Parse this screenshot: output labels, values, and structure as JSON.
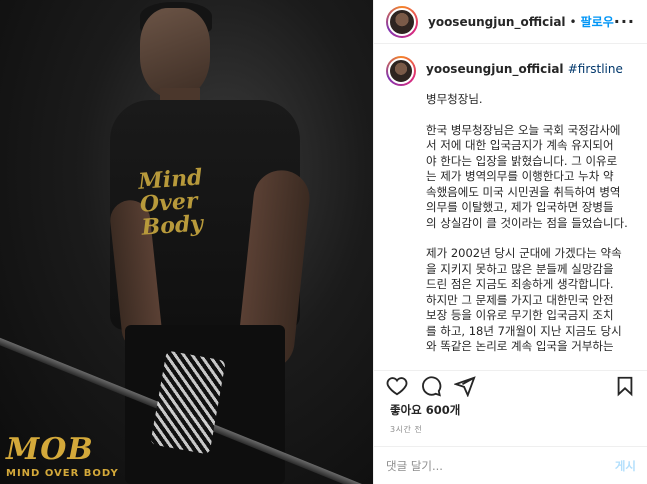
{
  "photo": {
    "shirt_lines": [
      "Mind",
      "Over",
      "Body"
    ],
    "logo": "MOB",
    "logo_sub": "MIND OVER BODY"
  },
  "header": {
    "username": "yooseungjun_official",
    "separator": "•",
    "follow_label": "팔로우",
    "more_icon": "ellipsis-icon"
  },
  "caption": {
    "username": "yooseungjun_official",
    "hashtag": "#firstline",
    "paragraphs": [
      "병무청장님.",
      "한국 병무청장님은 오늘 국회 국정감사에\n서 저에 대한 입국금지가 계속 유지되어\n야 한다는 입장을 밝혔습니다.  그 이유로\n는 제가 병역의무를 이행한다고 누차 약\n속했음에도 미국 시민권을 취득하여 병역\n의무를 이탈했고, 제가 입국하면 장병들\n의 상실감이 클 것이라는 점을 들었습니다.",
      "제가 2002년 당시 군대에 가겠다는 약속\n을 지키지 못하고 많은 분들께 실망감을\n드린 점은 지금도 죄송하게 생각합니다.\n하지만 그 문제를 가지고 대한민국 안전\n보장 등을 이유로 무기한 입국금지 조치\n를 하고, 18년 7개월이 지난 지금도 당시\n와 똑같은 논리로 계속 입국을 거부하는"
    ]
  },
  "actions": {
    "icons": [
      "heart-icon",
      "comment-icon",
      "share-icon",
      "bookmark-icon"
    ]
  },
  "likes": "좋아요 600개",
  "time": "3시간 전",
  "comment": {
    "placeholder": "댓글 달기...",
    "post_label": "게시"
  }
}
